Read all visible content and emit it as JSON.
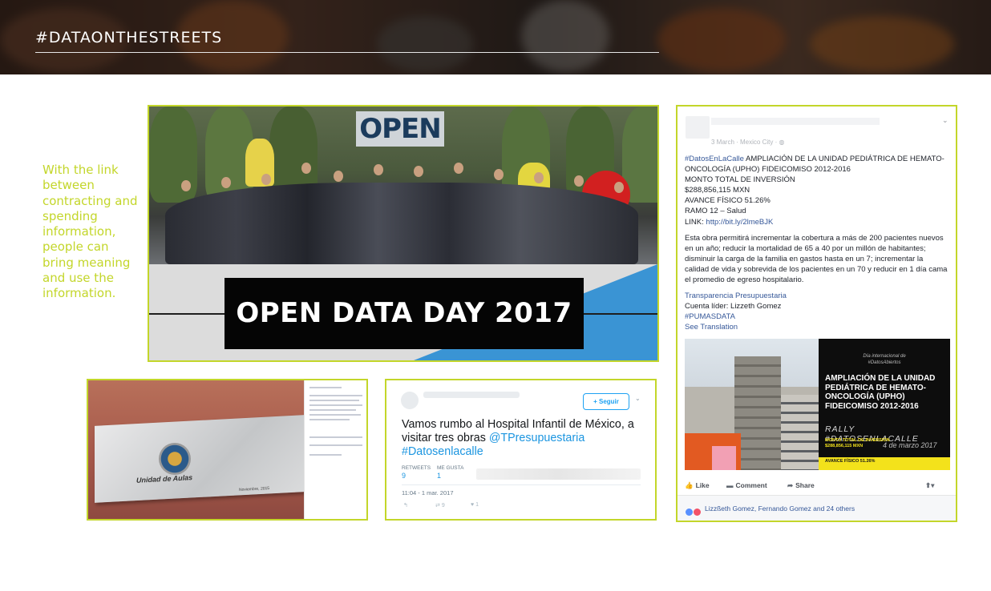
{
  "header": {
    "title": "#DATAONTHESTREETS"
  },
  "caption": {
    "text": "With the link between contracting and spending information, people can bring meaning and use the information."
  },
  "hero": {
    "sign_text": "OPEN",
    "banner_text": "OPEN DATA DAY 2017"
  },
  "plaque": {
    "title": "Unidad de Aulas",
    "date": "Noviembre, 2015"
  },
  "tweet": {
    "follow_label": "Seguir",
    "text_plain": "Vamos rumbo al Hospital Infantil de México, a visitar tres obras ",
    "mention": "@TPresupuestaria",
    "hashtag": "#Datosenlacalle",
    "retweets_label": "RETWEETS",
    "retweets_count": "9",
    "likes_label": "ME GUSTA",
    "likes_count": "1",
    "timestamp": "11:04 - 1 mar. 2017",
    "action_retweet_count": "9",
    "action_like_count": "1"
  },
  "facebook": {
    "meta": "3 March · Mexico City · ",
    "hashtag": "#DatosEnLaCalle",
    "headline": " AMPLIACIÓN DE LA UNIDAD PEDIÁTRICA DE HEMATO-ONCOLOGÍA (UPHO) FIDEICOMISO 2012-2016",
    "line_total": "MONTO TOTAL DE INVERSIÓN",
    "line_amount": "$288,856,115 MXN",
    "line_avance": "AVANCE FÍSICO 51.26%",
    "line_ramo": "RAMO 12 – Salud",
    "link_label": "LINK: ",
    "link_url": "http://bit.ly/2lmeBJK",
    "paragraph": "Esta obra permitirá incrementar la cobertura a más de 200 pacientes nuevos en un año; reducir la mortalidad de 65 a 40 por un millón de habitantes; disminuir la carga de la familia en gastos hasta en un 7; incrementar la calidad de vida y sobrevida de los pacientes en un 70 y reducir en 1 día cama el promedio de egreso hospitalario.",
    "page_link": "Transparencia Presupuestaria",
    "leader": "Cuenta líder: Lizzeth Gomez",
    "tag": "#PUMASDATA",
    "see_translation": "See Translation",
    "poster": {
      "tag_line_1": "Día internacional de",
      "tag_line_2": "#DatosAbiertos",
      "title": "AMPLIACIÓN DE LA UNIDAD PEDIÁTRICA DE HEMATO-ONCOLOGÍA (UPHO) FIDEICOMISO 2012-2016",
      "rally": "RALLY #DATOSENLACALLE",
      "amount_label": "MONTO TOTAL DE INVERSIÓN",
      "amount": "$288,856,115 MXN",
      "avance": "AVANCE FÍSICO 51.26%",
      "signature": "4 de marzo 2017"
    },
    "actions": {
      "like": "Like",
      "comment": "Comment",
      "share": "Share"
    },
    "reactions": "Lizzßeth Gomez, Fernando Gomez and 24 others"
  }
}
